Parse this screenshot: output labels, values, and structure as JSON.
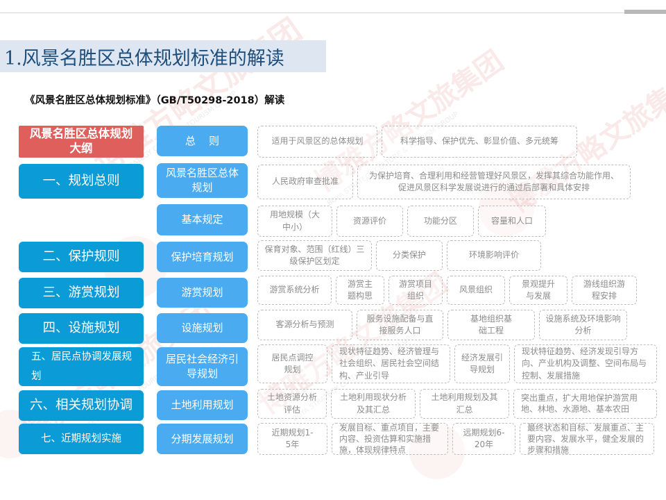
{
  "page": {
    "title": "1.风景名胜区总体规划标准的解读",
    "subtitle": "《风景名胜区总体规划标准》（GB/T50298-2018）解读"
  },
  "left": {
    "header": "风景名胜区总体规划大纲",
    "items": [
      "一、规划总则",
      "二、保护规则",
      "三、游赏规划",
      "四、设施规划",
      "五、居民点协调发展规划",
      "六、相关规划协调",
      "七、近期规划实施"
    ]
  },
  "middle": {
    "items": [
      "总    则",
      "风景名胜区总体规划",
      "基本规定",
      "保护培育规划",
      "游赏规划",
      "设施规划",
      "居民社会经济引导规划",
      "土地利用规划",
      "分期发展规划"
    ]
  },
  "rows": {
    "r1": [
      "适用于风景区的总体规划",
      "科学指导、保护优先、彰显价值、多元统筹"
    ],
    "r2": [
      "人民政府审查批准",
      "为保护培育、合理利用和经营管理好风景区，发挥其综合功能作用、促进风景区科学发展说进行的通过后部署和具体安排"
    ],
    "r3": [
      "用地规模（大中小）",
      "资源评价",
      "功能分区",
      "容量和人口"
    ],
    "r4": [
      "保育对象、范围（红线）三级保护区划定",
      "分类保护",
      "环境影响评价"
    ],
    "r5": [
      "游赏系统分析",
      "游赏主题构思",
      "游赏项目组织",
      "风景组织",
      "景观提升与发展",
      "游线组织游程安排"
    ],
    "r6": [
      "客源分析与预测",
      "服务设施配备与直接服务人口",
      "基地组织基础工程",
      "设施系统及环境影响分析"
    ],
    "r7": [
      "居民点调控规划",
      "现状特征趋势、经济管理与社会组织、居民社会空间结构、产业引导",
      "经济发展引导规划",
      "现状特征趋势、经济发现引导方向、产业机构及调整、空间布局与控制、发展措施"
    ],
    "r8": [
      "土地资源分析评估",
      "土地利用现状分析及其汇总",
      "土地利用规划及其汇总",
      "突出重点，扩大用地保护游赏用地、林地、水源地、基本农田"
    ],
    "r9": [
      "近期规划1-5年",
      "发展目标、重点项目，主要内容、投资估算和实施措施，体现规律特点",
      "远期规划6-20年",
      "最终状态和目标、发展重点、主要内容、发展水平，健全发展的步骤和措施"
    ]
  },
  "watermark": {
    "zh": "博雅方略文旅集团",
    "en": "BOYA STRATEGY CULTURE & TOURISM GROUP"
  },
  "colors": {
    "left_blue": "#0b9bd7",
    "header_red": "#df5f5c",
    "middle_blue": "#4aabf0",
    "title_band": "#dde6f1",
    "title_text": "#1d4e7c",
    "dashed_border": "#bdbdbd"
  }
}
